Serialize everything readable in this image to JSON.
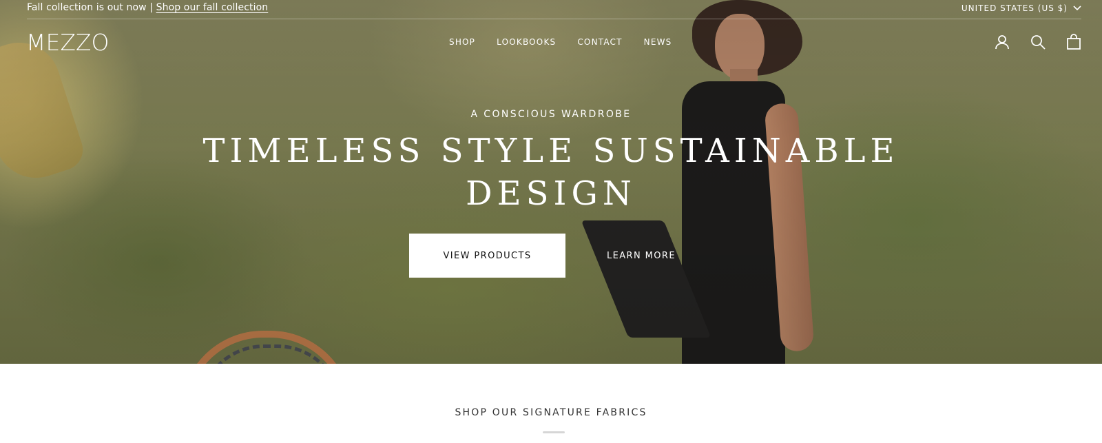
{
  "announcement": {
    "text": "Fall collection is out now | ",
    "link_label": "Shop our fall collection"
  },
  "region": {
    "label": "UNITED STATES (US $)"
  },
  "header": {
    "logo": "MEZZO",
    "nav": [
      "SHOP",
      "LOOKBOOKS",
      "CONTACT",
      "NEWS"
    ],
    "icons": [
      "account-icon",
      "search-icon",
      "cart-icon"
    ]
  },
  "hero": {
    "kicker": "A CONSCIOUS WARDROBE",
    "headline_line1": "TIMELESS STYLE SUSTAINABLE",
    "headline_line2": "DESIGN",
    "primary_button": "VIEW PRODUCTS",
    "secondary_link": "LEARN MORE"
  },
  "section": {
    "title": "SHOP OUR SIGNATURE FABRICS"
  },
  "colors": {
    "text_on_hero": "#ffffff",
    "button_bg": "#ffffff",
    "button_text": "#111111",
    "section_text": "#333333"
  }
}
